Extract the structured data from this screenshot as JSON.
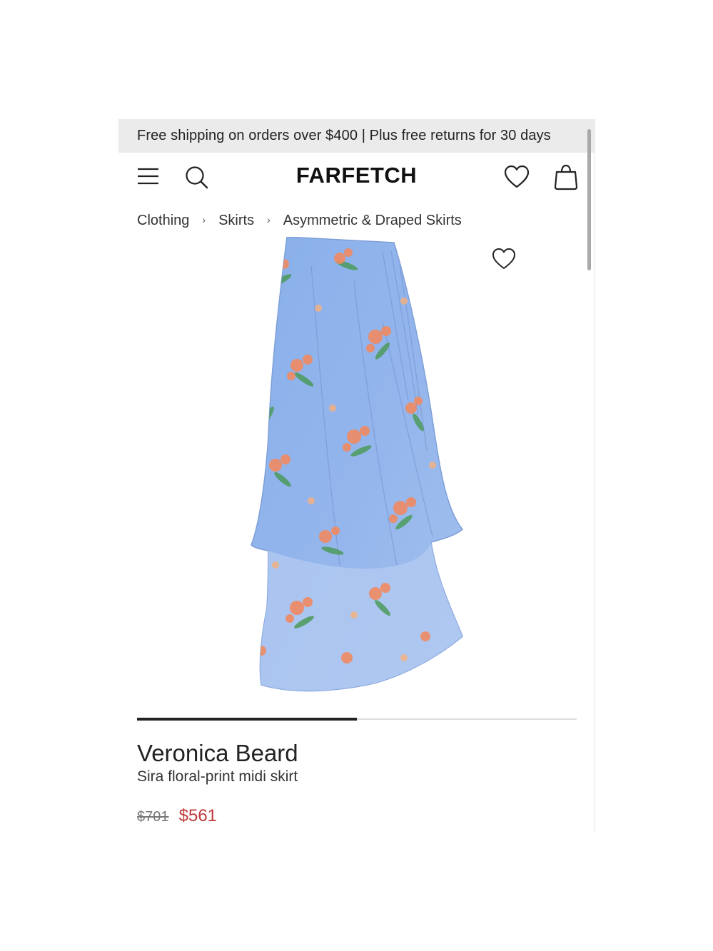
{
  "banner": {
    "text": "Free shipping on orders over $400 | Plus free returns for 30 days"
  },
  "header": {
    "logo": "FARFETCH",
    "icons": [
      "menu-icon",
      "search-icon",
      "heart-icon",
      "bag-icon"
    ]
  },
  "breadcrumb": [
    {
      "label": "Clothing"
    },
    {
      "label": "Skirts"
    },
    {
      "label": "Asymmetric & Draped Skirts"
    }
  ],
  "breadcrumb_separator": "›",
  "gallery": {
    "progress_fraction": 0.5,
    "image_colors": {
      "fabric": "#8fb0e6",
      "flower": "#f08a62",
      "leaf": "#4d9a5c"
    }
  },
  "product": {
    "brand": "Veronica Beard",
    "name": "Sira floral-print midi skirt",
    "original_price": "$701",
    "sale_price": "$561"
  },
  "colors": {
    "banner_bg": "#ebebeb",
    "sale_price": "#c0393b",
    "progress": "#222222"
  }
}
